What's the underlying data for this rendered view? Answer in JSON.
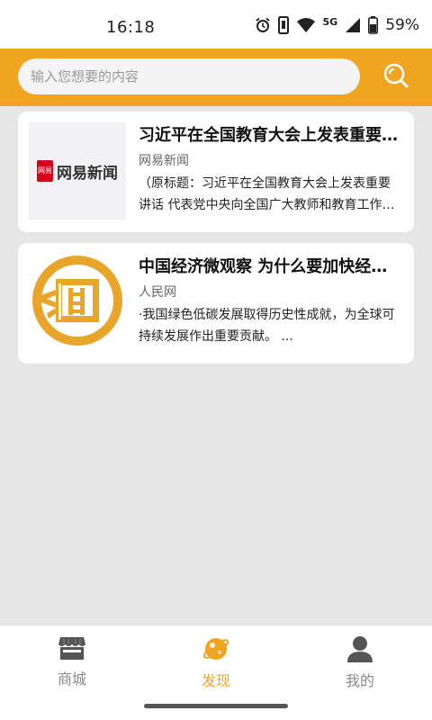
{
  "status_bar": {
    "time": "16:18",
    "network": "5G",
    "battery": "59%"
  },
  "search": {
    "placeholder": "输入您想要的内容"
  },
  "colors": {
    "accent": "#efa51f",
    "background": "#e6e6e6",
    "card": "#ffffff"
  },
  "news": [
    {
      "title": "习近平在全国教育大会上发表重要讲话",
      "source": "网易新闻",
      "summary": "（原标题：习近平在全国教育大会上发表重要讲话 代表党中央向全国广大教师和教育工作者致以节日问候",
      "thumb_text": "网易新闻",
      "thumb_badge": "网易"
    },
    {
      "title": "中国经济微观察 为什么要加快经济社会发展全面绿色转型",
      "source": "人民网",
      "summary": "·我国绿色低碳发展取得历史性成就，为全球可持续发展作出重要贡献。 ...",
      "thumb_text": ""
    }
  ],
  "bottom_nav": {
    "items": [
      {
        "label": "商城",
        "icon": "shop-icon",
        "active": false
      },
      {
        "label": "发现",
        "icon": "planet-icon",
        "active": true
      },
      {
        "label": "我的",
        "icon": "user-icon",
        "active": false
      }
    ]
  }
}
